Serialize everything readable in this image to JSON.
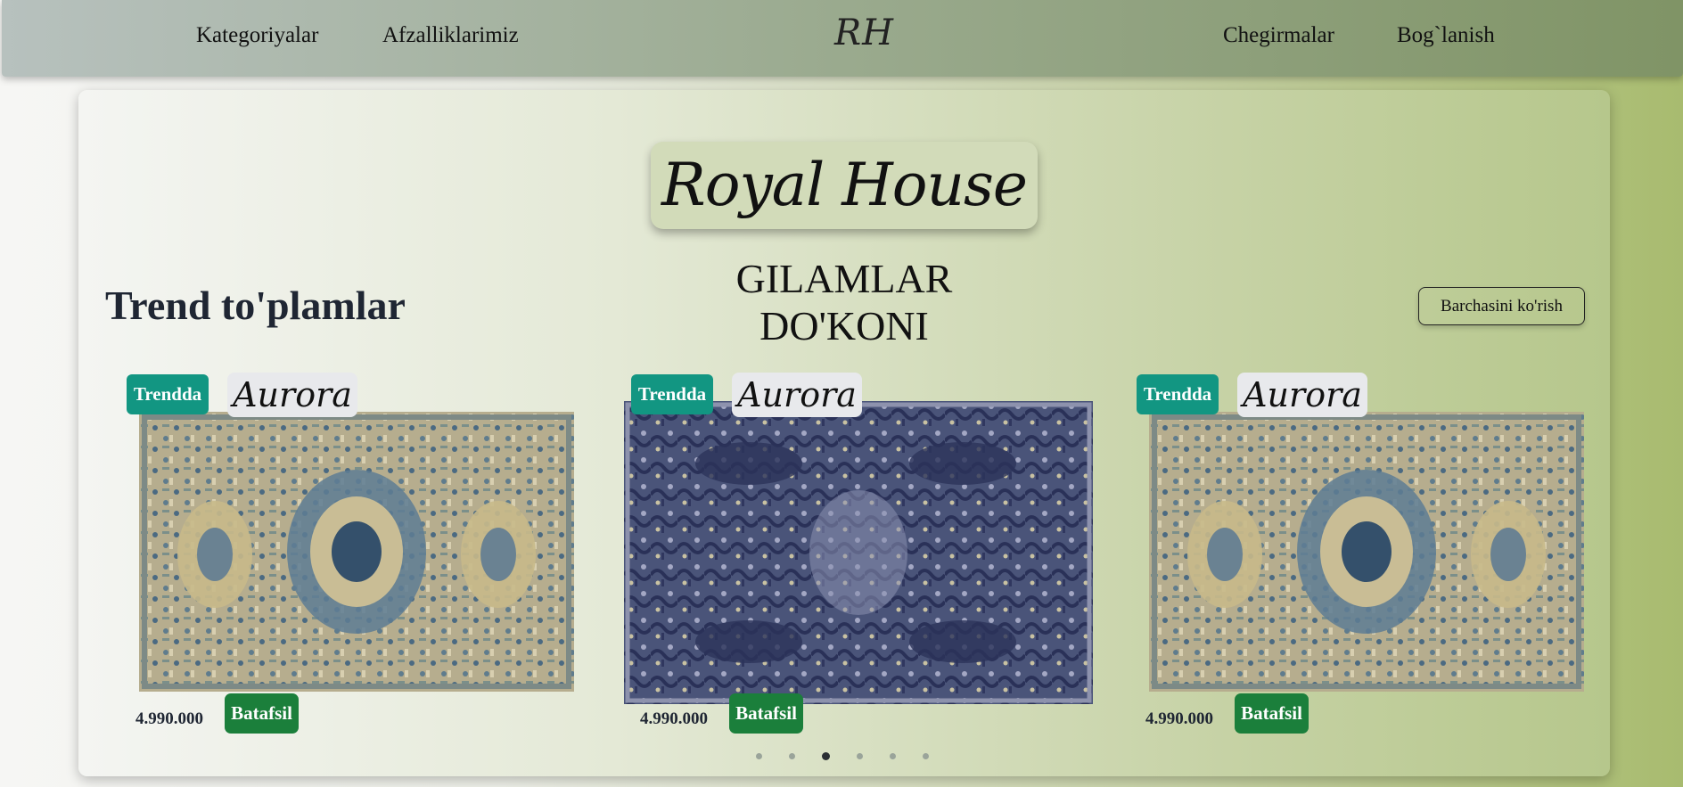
{
  "nav": {
    "links_left": [
      "Kategoriyalar",
      "Afzalliklarimiz"
    ],
    "logo": "RH",
    "links_right": [
      "Chegirmalar",
      "Bog`lanish"
    ]
  },
  "hero": {
    "brand": "Royal House",
    "subtitle": "GILAMLAR DO'KONI"
  },
  "section": {
    "title": "Trend to'plamlar",
    "see_all": "Barchasini ko'rish"
  },
  "products": [
    {
      "badge": "Trendda",
      "name": "Aurora",
      "price": "4.990.000",
      "button": "Batafsil",
      "rug_style": "beige-medallion"
    },
    {
      "badge": "Trendda",
      "name": "Aurora",
      "price": "4.990.000",
      "button": "Batafsil",
      "rug_style": "navy-distressed"
    },
    {
      "badge": "Trendda",
      "name": "Aurora",
      "price": "4.990.000",
      "button": "Batafsil",
      "rug_style": "beige-medallion"
    }
  ],
  "carousel": {
    "dot_count": 6,
    "active_index": 2
  },
  "colors": {
    "badge": "#129682",
    "detail_button": "#1b7f3b"
  }
}
